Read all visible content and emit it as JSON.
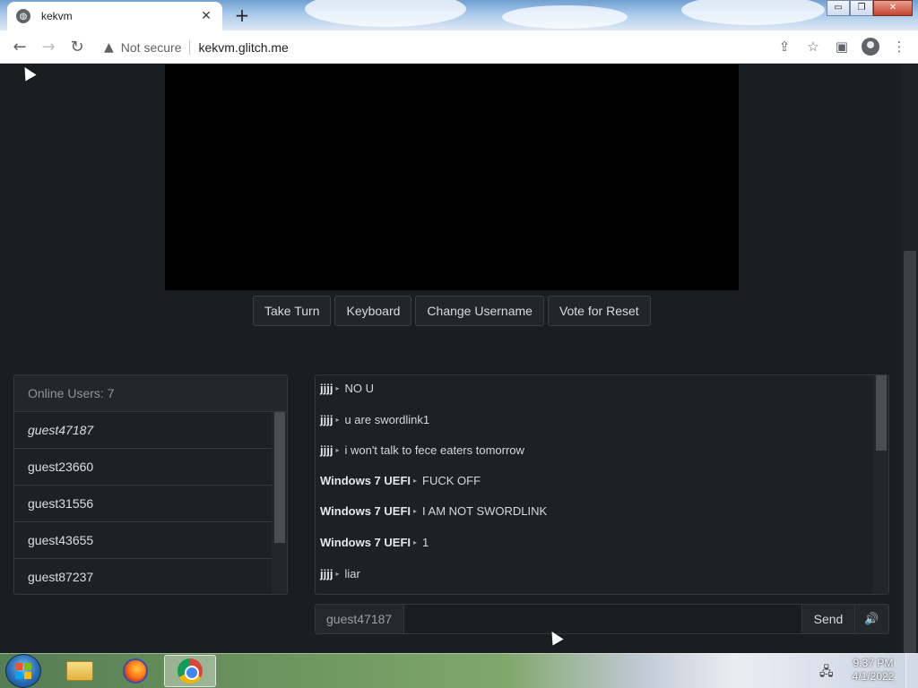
{
  "browser": {
    "tab_title": "kekvm",
    "tab_close": "✕",
    "new_tab": "+",
    "security_label": "Not secure",
    "url": "kekvm.glitch.me",
    "window_controls": {
      "minimize": "▭",
      "restore": "❐",
      "close": "✕"
    },
    "icons": [
      "back-arrow-icon",
      "forward-arrow-icon",
      "reload-icon",
      "warning-icon",
      "share-icon",
      "star-icon",
      "side-panel-icon",
      "profile-icon",
      "menu-icon"
    ]
  },
  "vm": {
    "buttons": {
      "take_turn": "Take Turn",
      "keyboard": "Keyboard",
      "change_username": "Change Username",
      "vote_reset": "Vote for Reset"
    }
  },
  "users": {
    "header": "Online Users: 7",
    "list": [
      "guest47187",
      "guest23660",
      "guest31556",
      "guest43655",
      "guest87237"
    ]
  },
  "chat": {
    "messages": [
      {
        "user": "jjjj",
        "text": "NO U"
      },
      {
        "user": "jjjj",
        "text": "u are swordlink1"
      },
      {
        "user": "jjjj",
        "text": "i won't talk to fece eaters tomorrow"
      },
      {
        "user": "Windows 7 UEFI",
        "text": "FUCK OFF"
      },
      {
        "user": "Windows 7 UEFI",
        "text": "I AM NOT SWORDLINK"
      },
      {
        "user": "Windows 7 UEFI",
        "text": "1"
      },
      {
        "user": "jjjj",
        "text": "liar"
      }
    ],
    "separator": "▸",
    "input_prefix": "guest47187",
    "input_value": "",
    "send_label": "Send",
    "sound_icon": "🔊"
  },
  "taskbar": {
    "apps": [
      "windows-explorer-icon",
      "firefox-icon",
      "chrome-icon"
    ],
    "time": "9:37 PM",
    "date": "4/1/2022"
  },
  "colors": {
    "page_background": "#1b1e21",
    "panel_background": "#1e2124",
    "border": "#34383c"
  }
}
